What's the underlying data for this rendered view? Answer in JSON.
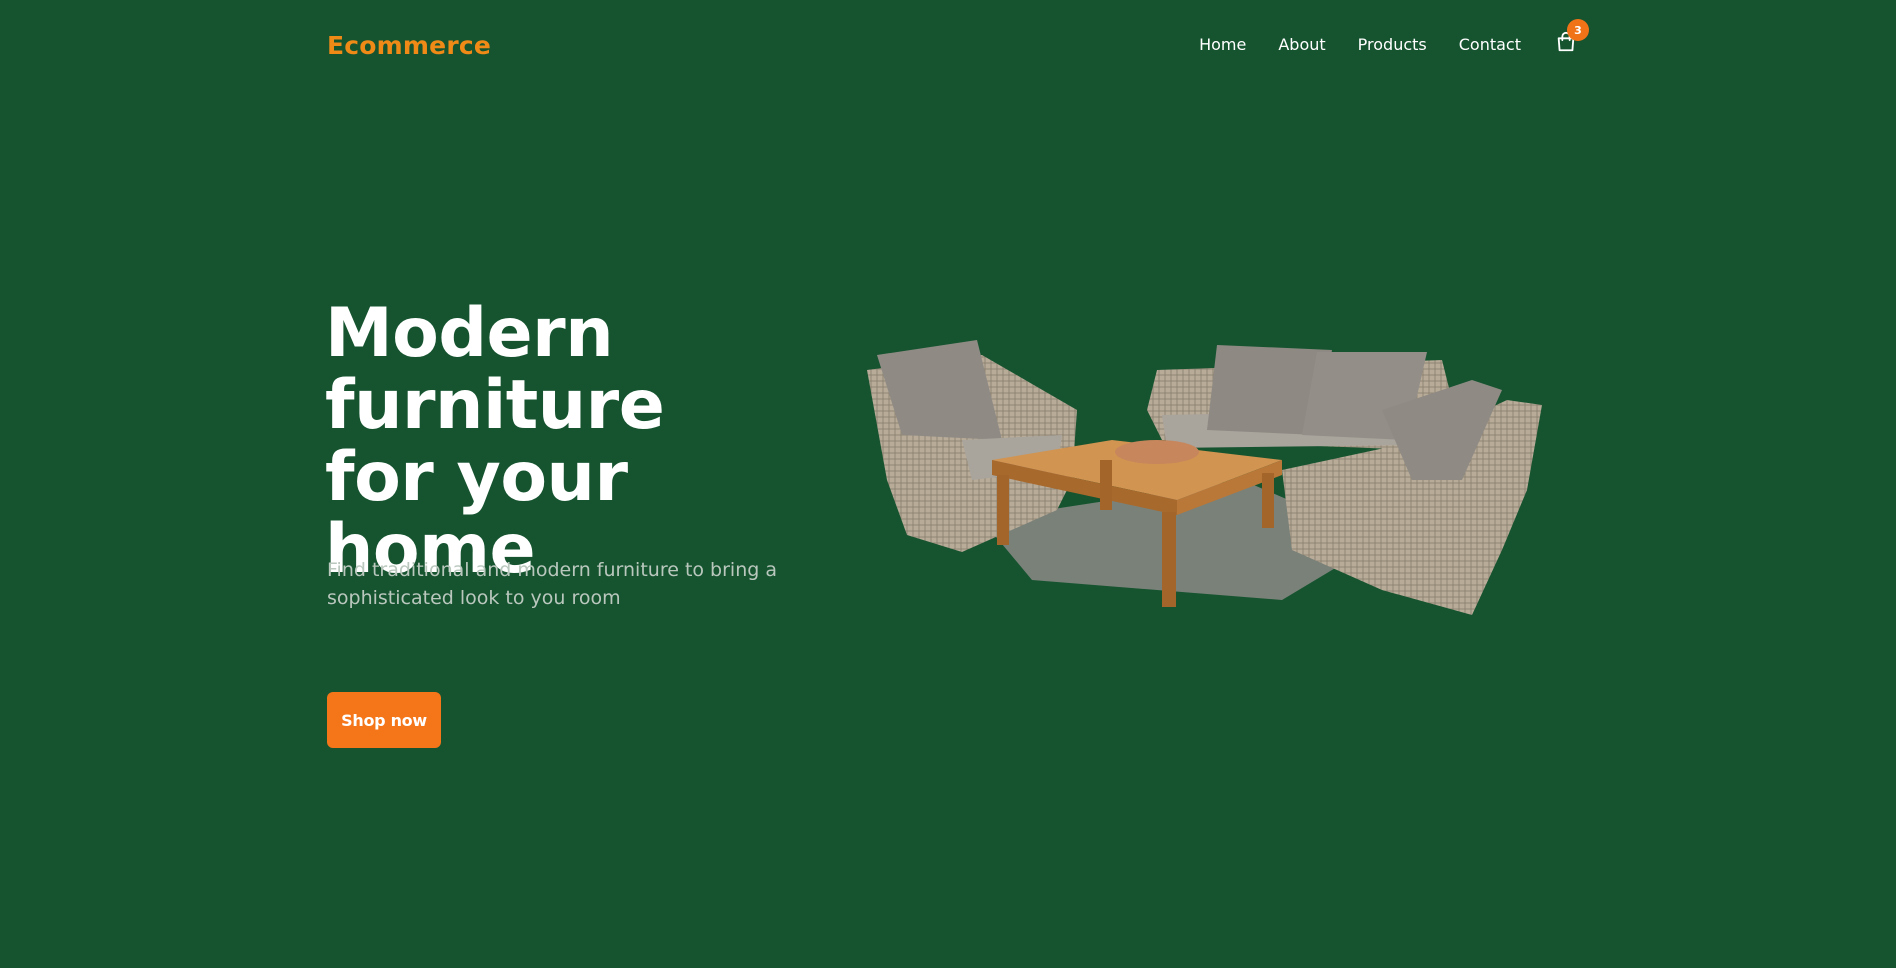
{
  "brand": {
    "name": "Ecommerce",
    "accent": "#f08a17"
  },
  "nav": {
    "items": [
      {
        "label": "Home"
      },
      {
        "label": "About"
      },
      {
        "label": "Products"
      },
      {
        "label": "Contact"
      }
    ],
    "cart": {
      "icon": "shopping-bag-icon",
      "count": "3"
    }
  },
  "hero": {
    "title": "Modern furniture for your home",
    "subtitle": "Find traditional and modern furniture to bring a sophisticated look to you room",
    "cta_label": "Shop now",
    "cta_color": "#f57619",
    "image": "patio-furniture-set-image"
  },
  "colors": {
    "background": "#165430",
    "text": "#ffffff",
    "subtext": "#b9c7bd"
  }
}
